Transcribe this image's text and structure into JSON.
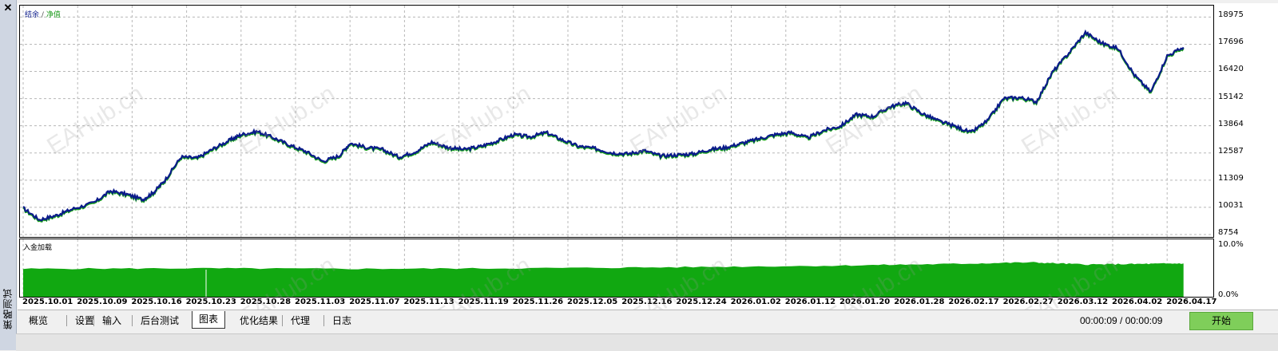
{
  "window": {
    "close_glyph": "✕",
    "side_title": "策略测试"
  },
  "legend": {
    "balance": "结余",
    "separator": "/",
    "equity": "净值"
  },
  "sub_chart_label": "入金加载",
  "tabs": [
    {
      "label": "概览",
      "active": false
    },
    {
      "label": "设置",
      "active": false
    },
    {
      "label": "输入",
      "active": false
    },
    {
      "label": "后台测试",
      "active": false
    },
    {
      "label": "图表",
      "active": true
    },
    {
      "label": "优化结果",
      "active": false
    },
    {
      "label": "代理",
      "active": false
    },
    {
      "label": "日志",
      "active": false
    }
  ],
  "timer": "00:00:09 / 00:00:09",
  "start_button": "开始",
  "watermark": "EAHub.cn",
  "colors": {
    "balance": "#0a1a8a",
    "equity": "#1aa31a",
    "load_fill": "#11a811",
    "start_button": "#7fce5a"
  },
  "chart_data": [
    {
      "type": "line",
      "title": "",
      "ylabel": "",
      "xlabel": "",
      "ylim": [
        8754,
        19400
      ],
      "y_ticks": [
        "18975",
        "17696",
        "16420",
        "15142",
        "13864",
        "12587",
        "11309",
        "10031",
        "8754"
      ],
      "x_ticks": [
        "2025.10.01",
        "2025.10.09",
        "2025.10.16",
        "2025.10.23",
        "2025.10.28",
        "2025.11.03",
        "2025.11.07",
        "2025.11.13",
        "2025.11.19",
        "2025.11.26",
        "2025.12.05",
        "2025.12.16",
        "2025.12.24",
        "2026.01.02",
        "2026.01.12",
        "2026.01.20",
        "2026.01.28",
        "2026.02.17",
        "2026.02.27",
        "2026.03.12",
        "2026.04.02",
        "2026.04.17"
      ],
      "grid": true,
      "series": [
        {
          "name": "结余",
          "x_index": [
            0,
            0.3,
            0.6,
            0.9,
            1.3,
            1.6,
            1.9,
            2.2,
            2.4,
            2.6,
            2.9,
            3.2,
            3.5,
            3.8,
            4.0,
            4.3,
            4.6,
            4.9,
            5.2,
            5.5,
            5.8,
            6.0,
            6.3,
            6.6,
            6.9,
            7.2,
            7.5,
            7.8,
            8.1,
            8.4,
            8.7,
            9.0,
            9.3,
            9.6,
            9.9,
            10.2,
            10.5,
            10.8,
            11.1,
            11.4,
            11.7,
            12.0,
            12.3,
            12.6,
            12.9,
            13.2,
            13.5,
            13.8,
            14.1,
            14.4,
            14.7,
            15.0,
            15.3,
            15.6,
            15.9,
            16.2,
            16.5,
            16.8,
            17.1,
            17.4,
            17.7,
            18.0,
            18.3,
            18.6,
            18.9,
            19.2,
            19.5,
            19.8,
            20.1,
            20.4,
            20.7,
            21.0,
            21.3
          ],
          "values": [
            10000,
            9450,
            9650,
            9950,
            10250,
            10800,
            10650,
            10400,
            10750,
            11300,
            12400,
            12350,
            12800,
            13200,
            13450,
            13600,
            13300,
            12950,
            12650,
            12200,
            12450,
            13050,
            12850,
            12750,
            12400,
            12650,
            13100,
            12850,
            12750,
            12900,
            13150,
            13450,
            13350,
            13550,
            13200,
            12900,
            12800,
            12600,
            12550,
            12700,
            12450,
            12500,
            12550,
            12750,
            12850,
            13050,
            13250,
            13450,
            13550,
            13300,
            13650,
            13850,
            14400,
            14300,
            14750,
            14950,
            14450,
            14100,
            13850,
            13550,
            14100,
            15150,
            15200,
            15000,
            16400,
            17300,
            18250,
            17750,
            17500,
            16250,
            15450,
            17150,
            17550
          ]
        },
        {
          "name": "净值",
          "x_index": [
            0,
            0.3,
            0.6,
            0.9,
            1.3,
            1.6,
            1.9,
            2.2,
            2.4,
            2.6,
            2.9,
            3.2,
            3.5,
            3.8,
            4.0,
            4.3,
            4.6,
            4.9,
            5.2,
            5.5,
            5.8,
            6.0,
            6.3,
            6.6,
            6.9,
            7.2,
            7.5,
            7.8,
            8.1,
            8.4,
            8.7,
            9.0,
            9.3,
            9.6,
            9.9,
            10.2,
            10.5,
            10.8,
            11.1,
            11.4,
            11.7,
            12.0,
            12.3,
            12.6,
            12.9,
            13.2,
            13.5,
            13.8,
            14.1,
            14.4,
            14.7,
            15.0,
            15.3,
            15.6,
            15.9,
            16.2,
            16.5,
            16.8,
            17.1,
            17.4,
            17.7,
            18.0,
            18.3,
            18.6,
            18.9,
            19.2,
            19.5,
            19.8,
            20.1,
            20.4,
            20.7,
            21.0,
            21.3
          ],
          "values": [
            9950,
            9400,
            9600,
            9900,
            10200,
            10750,
            10600,
            10350,
            10700,
            11250,
            12350,
            12300,
            12750,
            13150,
            13400,
            13550,
            13250,
            12900,
            12600,
            12150,
            12400,
            13000,
            12800,
            12700,
            12350,
            12600,
            13050,
            12800,
            12700,
            12850,
            13100,
            13400,
            13300,
            13500,
            13150,
            12850,
            12750,
            12550,
            12500,
            12650,
            12400,
            12450,
            12500,
            12700,
            12800,
            13000,
            13200,
            13400,
            13500,
            13250,
            13600,
            13800,
            14350,
            14250,
            14700,
            14900,
            14400,
            14050,
            13800,
            13500,
            14050,
            15100,
            15150,
            14950,
            16350,
            17250,
            18200,
            17700,
            17450,
            16200,
            15400,
            17100,
            17500
          ]
        }
      ]
    },
    {
      "type": "area",
      "title": "",
      "ylim": [
        0,
        10
      ],
      "y_ticks": [
        "10.0%",
        "0.0%"
      ],
      "series": [
        {
          "name": "入金加载",
          "x_index": [
            0,
            3,
            6,
            9,
            12,
            15,
            17,
            18.5,
            19.5,
            20.5,
            21.3
          ],
          "values": [
            5.0,
            5.1,
            5.0,
            5.1,
            5.3,
            5.6,
            5.9,
            6.2,
            5.8,
            5.9,
            6.0
          ]
        }
      ]
    }
  ]
}
